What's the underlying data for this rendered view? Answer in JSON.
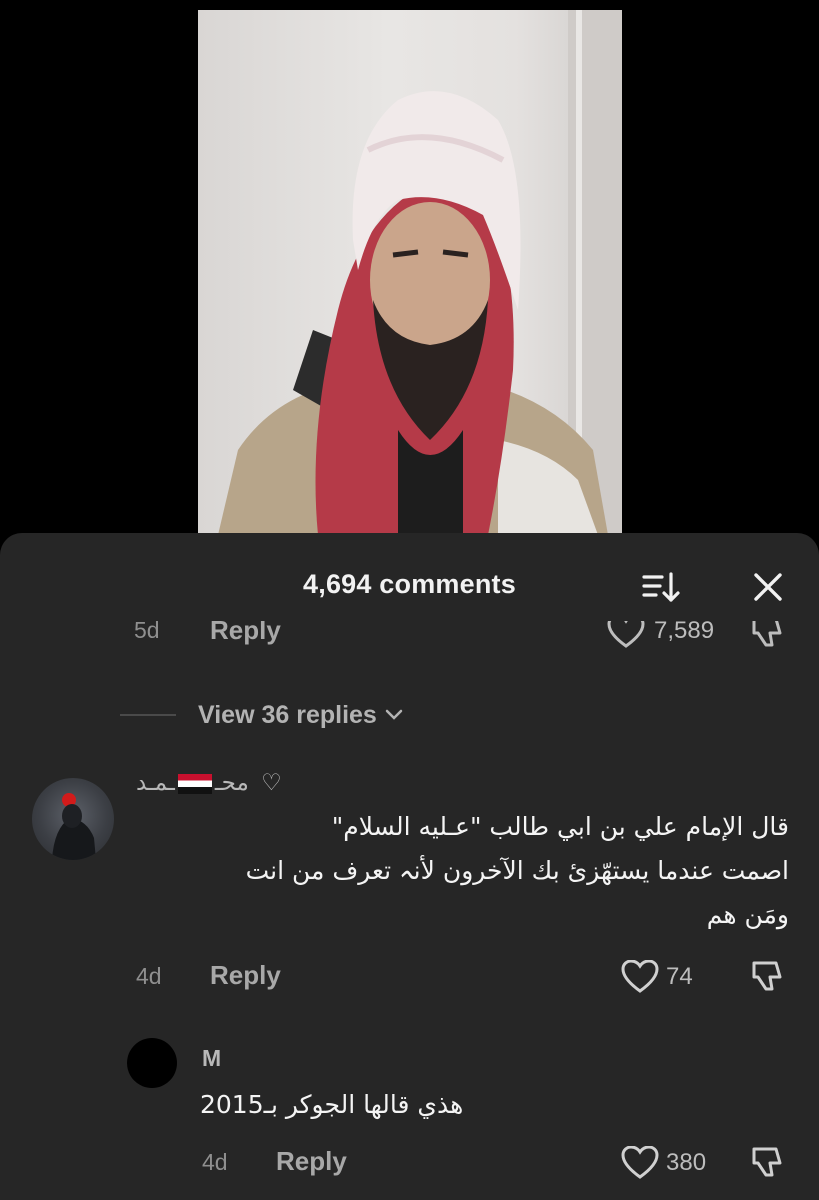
{
  "sheet": {
    "title": "4,694 comments"
  },
  "partial_comment": {
    "age": "5d",
    "reply_label": "Reply",
    "likes": "7,589"
  },
  "view_replies": {
    "label": "View 36 replies"
  },
  "comment1": {
    "username_prefix": "محـ",
    "username_suffix": "ـمـد",
    "text_lines": [
      "قال الإمام علي بن ابي طالب \"عـليه السلام\"",
      "اصمت عندما يستهّزئ بك الآخرون لأنہ تعرف من انت",
      "ومَن هم"
    ],
    "age": "4d",
    "reply_label": "Reply",
    "likes": "74"
  },
  "comment2": {
    "username": "M",
    "text": "هذي قالها الجوكر بـ2015",
    "age": "4d",
    "reply_label": "Reply",
    "likes": "380"
  },
  "colors": {
    "sheet_bg": "#262626",
    "flag_red": "#c8102e",
    "text_primary": "#f4f4f4",
    "text_muted": "#9a9a9a"
  },
  "icons": [
    "sort-icon",
    "close-icon",
    "heart-icon",
    "dislike-icon",
    "chevron-down-icon",
    "heart-outline-icon"
  ]
}
